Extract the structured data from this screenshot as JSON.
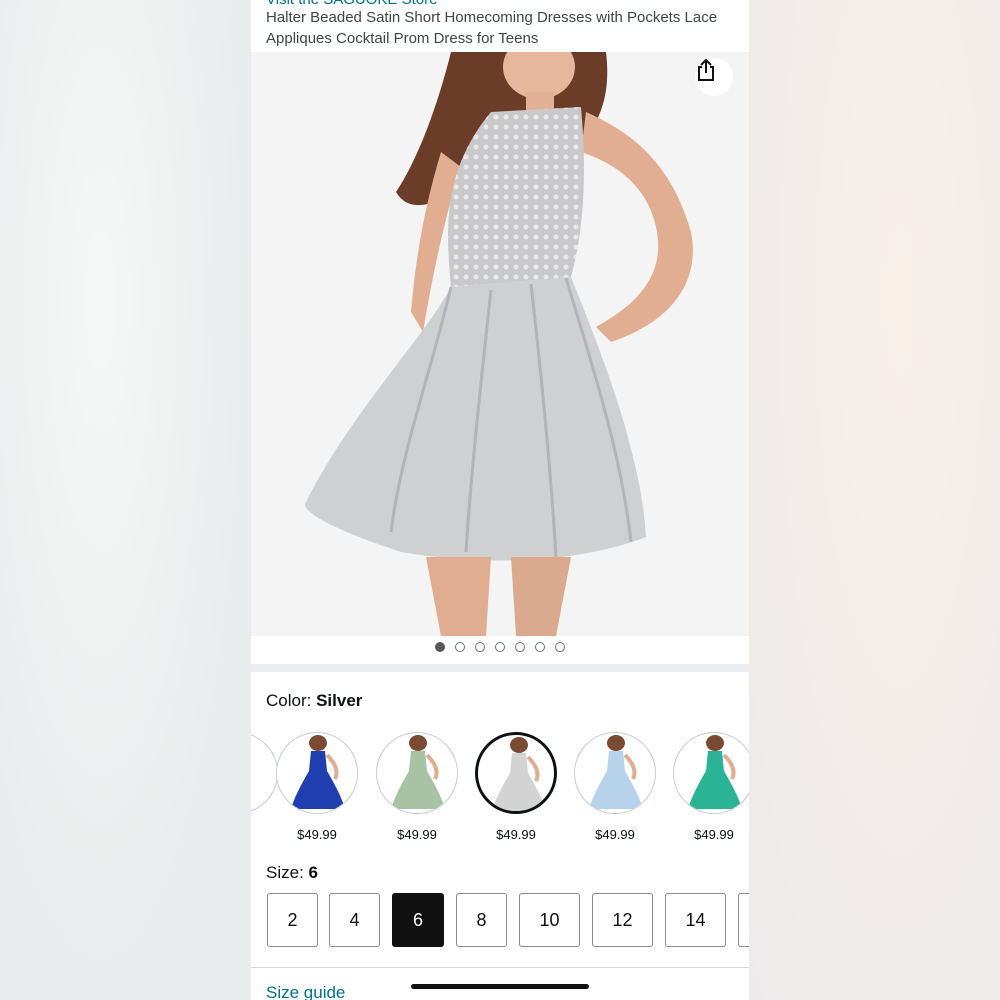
{
  "product": {
    "store_link": "Visit the SAGUOKE Store",
    "title": "Halter Beaded Satin Short Homecoming Dresses with Pockets Lace Appliques Cocktail Prom Dress for Teens"
  },
  "gallery": {
    "share_icon": "share-icon",
    "image_count": 7,
    "active_index": 0
  },
  "color": {
    "label": "Color: ",
    "selected": "Silver",
    "swatches": [
      {
        "color": "#ffffff",
        "price": ""
      },
      {
        "color": "#1f3fb0",
        "price": "$49.99"
      },
      {
        "color": "#a7c3a3",
        "price": "$49.99"
      },
      {
        "color": "#d3d3d3",
        "price": "$49.99"
      },
      {
        "color": "#b7d3ec",
        "price": "$49.99"
      },
      {
        "color": "#2ab394",
        "price": "$49.99"
      }
    ]
  },
  "size": {
    "label": "Size: ",
    "selected": "6",
    "options": [
      "2",
      "4",
      "6",
      "8",
      "10",
      "12",
      "14",
      ""
    ]
  },
  "size_guide": "Size guide"
}
